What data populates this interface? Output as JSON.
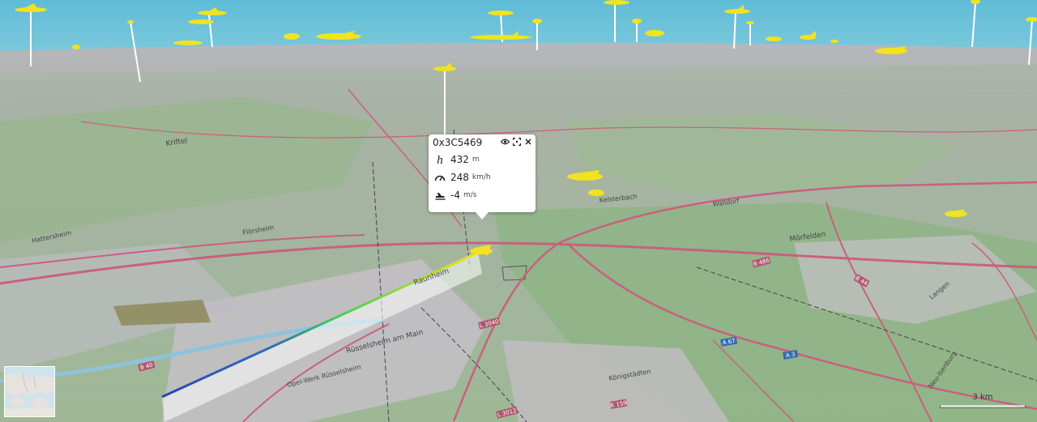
{
  "aircraft_popup": {
    "callsign": "0x3C5469",
    "altitude": {
      "value": "432",
      "unit": "m"
    },
    "speed": {
      "value": "248",
      "unit": "km/h"
    },
    "vertical_rate": {
      "value": "-4",
      "unit": "m/s"
    },
    "icons": [
      "eye-icon",
      "focus-icon",
      "close-icon",
      "altitude-icon",
      "speedometer-icon",
      "climb-rate-icon"
    ]
  },
  "map_labels": [
    "Rüsselsheim am Main",
    "Opel-Werk Rüsselsheim",
    "Kelsterbach",
    "Mörfelden",
    "Langen",
    "Neu-Isenburg",
    "Walldorf",
    "Raunheim",
    "Königstädten",
    "Flörsheim",
    "Kriftel",
    "Hattersheim"
  ],
  "road_labels": [
    "B 486",
    "B 44",
    "A 3",
    "A 67",
    "L 3012",
    "L 3040",
    "K 159",
    "B 40"
  ],
  "scale_bar": {
    "label": "3 km"
  },
  "colors": {
    "sky": "#70c2d8",
    "aircraft": "#f1e31f",
    "trail_start": "#2b47b8",
    "trail_end": "#f1e31f",
    "forest": "#86b07e",
    "urban": "#c8c3c9",
    "road": "#c9607e"
  }
}
